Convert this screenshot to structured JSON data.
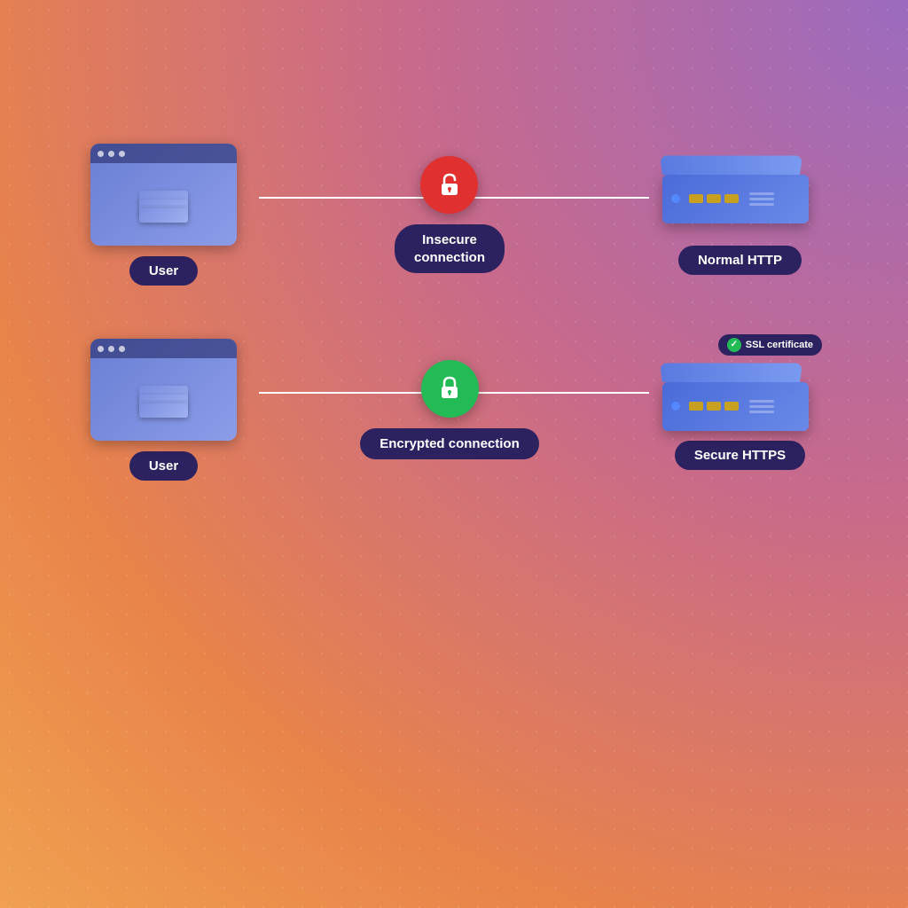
{
  "diagram": {
    "rows": [
      {
        "id": "http-row",
        "user_label": "User",
        "lock_type": "insecure",
        "connection_label": "Insecure\nconnection",
        "server_label": "Normal HTTP",
        "has_ssl": false
      },
      {
        "id": "https-row",
        "user_label": "User",
        "lock_type": "secure",
        "connection_label": "Encrypted\nconnection",
        "server_label": "Secure HTTPS",
        "has_ssl": true,
        "ssl_label": "SSL certificate"
      }
    ]
  }
}
